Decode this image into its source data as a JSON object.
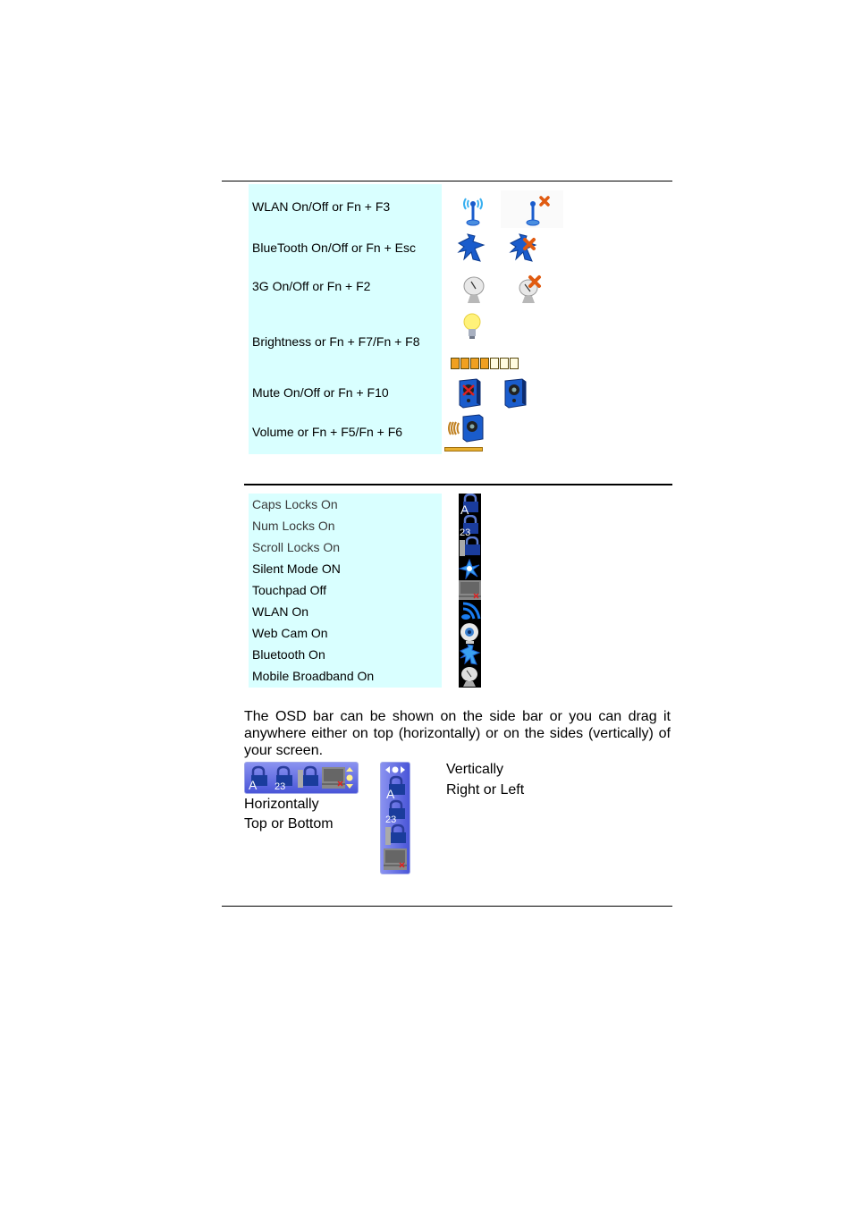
{
  "hotkeys_table": {
    "rows": [
      {
        "label": "WLAN On/Off or Fn + F3",
        "icons": [
          "wlan-on-icon",
          "wlan-off-icon"
        ]
      },
      {
        "label": "BlueTooth On/Off or Fn + Esc",
        "icons": [
          "bluetooth-on-icon",
          "bluetooth-off-icon"
        ]
      },
      {
        "label": "3G On/Off or Fn + F2",
        "icons": [
          "3g-on-icon",
          "3g-off-icon"
        ]
      },
      {
        "label": "Brightness or Fn + F7/Fn + F8",
        "icons": [
          "brightness-bulb-icon",
          "brightness-level-bar"
        ],
        "level": "4/7"
      },
      {
        "label": "Mute On/Off or Fn + F10",
        "icons": [
          "speaker-muted-icon",
          "speaker-icon"
        ]
      },
      {
        "label": "Volume or Fn + F5/Fn + F6",
        "icons": [
          "volume-speaker-icon",
          "volume-level-bar"
        ]
      }
    ]
  },
  "status_table": {
    "rows": [
      {
        "label": "Caps Locks On",
        "icon": "caps-lock-icon"
      },
      {
        "label": "Num Locks On",
        "icon": "num-lock-icon"
      },
      {
        "label": "Scroll Locks On",
        "icon": "scroll-lock-icon"
      },
      {
        "label": "Silent Mode ON",
        "icon": "silent-mode-icon"
      },
      {
        "label": "Touchpad Off",
        "icon": "touchpad-off-icon"
      },
      {
        "label": "WLAN On",
        "icon": "wlan-icon"
      },
      {
        "label": "Web Cam On",
        "icon": "webcam-icon"
      },
      {
        "label": "Bluetooth On",
        "icon": "bluetooth-icon"
      },
      {
        "label": "Mobile Broadband On",
        "icon": "mobile-broadband-icon"
      }
    ]
  },
  "description": "The OSD bar can be shown on the side bar or you can drag it anywhere either on top (horizontally) or on the sides (vertically) of your screen.",
  "horizontal": {
    "line1": "Horizontally",
    "line2": "Top or Bottom"
  },
  "vertical": {
    "line1": "Vertically",
    "line2": "Right or Left"
  },
  "colors": {
    "cell_bg": "#d9ffff",
    "osd_bar": "#5a64e0",
    "icon_blue": "#1a5ccc",
    "off_mark": "#e05a10"
  }
}
